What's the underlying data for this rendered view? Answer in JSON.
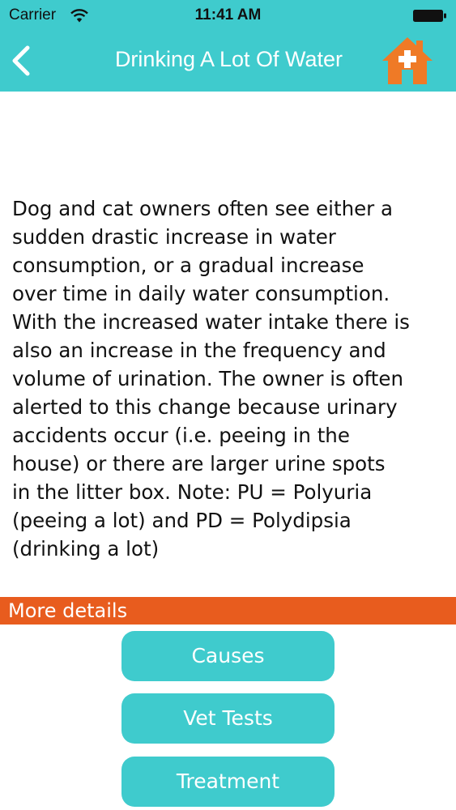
{
  "status_bar": {
    "carrier": "Carrier",
    "time": "11:41 AM",
    "icons": [
      "wifi-icon",
      "battery-icon"
    ]
  },
  "nav": {
    "title": "Drinking A Lot Of Water",
    "back_icon": "chevron-left-icon",
    "home_icon": "vet-home-icon"
  },
  "content": {
    "description": "Dog and cat owners often see either a\nsudden drastic increase in water\nconsumption, or a gradual increase\nover time in daily water consumption.\nWith the increased water intake there is\nalso an increase in the frequency and\nvolume of urination. The owner is often\nalerted to this change because urinary\naccidents occur (i.e. peeing in the\nhouse) or there are larger urine spots\nin the litter box. Note: PU = Polyuria\n(peeing a lot) and PD = Polydipsia\n(drinking a lot)"
  },
  "section": {
    "label": "More details"
  },
  "buttons": [
    {
      "label": "Causes"
    },
    {
      "label": "Vet Tests"
    },
    {
      "label": "Treatment"
    }
  ],
  "colors": {
    "accent": "#3fcbcd",
    "section": "#e85c1e",
    "home_icon": "#ef7a26"
  }
}
